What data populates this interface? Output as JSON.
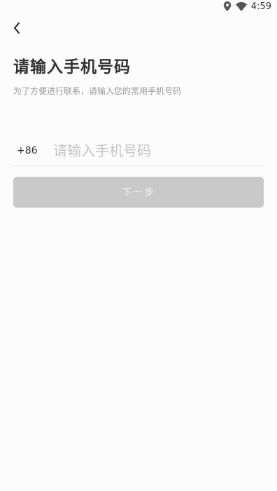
{
  "status_bar": {
    "time": "4:59",
    "icons": [
      "location-icon",
      "wifi-icon"
    ]
  },
  "header": {
    "back_icon": "chevron-left-icon"
  },
  "main": {
    "title": "请输入手机号码",
    "subtitle": "为了方便进行联系，请输入您的常用手机号码",
    "country_code": "+86",
    "phone_placeholder": "请输入手机号码",
    "phone_value": "",
    "next_label": "下一步"
  },
  "colors": {
    "background": "#fcfcfc",
    "button_disabled": "#c9c9c9",
    "title": "#333333",
    "subtitle": "#999999"
  }
}
